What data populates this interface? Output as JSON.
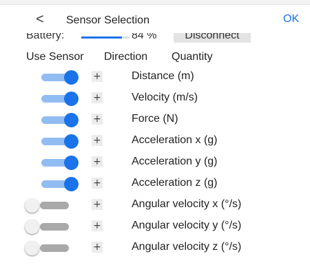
{
  "header": {
    "title": "Sensor Selection",
    "back_glyph": "<",
    "ok_label": "OK"
  },
  "status": {
    "battery_label": "Battery:",
    "battery_value": "84 %",
    "battery_level": 0.84,
    "disconnect_label": "Disconnect"
  },
  "columns": {
    "use_sensor": "Use Sensor",
    "direction": "Direction",
    "quantity": "Quantity"
  },
  "sensors": [
    {
      "quantity": "Distance (m)",
      "enabled": true,
      "direction_glyph": "+"
    },
    {
      "quantity": "Velocity (m/s)",
      "enabled": true,
      "direction_glyph": "+"
    },
    {
      "quantity": "Force (N)",
      "enabled": true,
      "direction_glyph": "+"
    },
    {
      "quantity": "Acceleration x (g)",
      "enabled": true,
      "direction_glyph": "+"
    },
    {
      "quantity": "Acceleration y (g)",
      "enabled": true,
      "direction_glyph": "+"
    },
    {
      "quantity": "Acceleration z (g)",
      "enabled": true,
      "direction_glyph": "+"
    },
    {
      "quantity": "Angular velocity x (°/s)",
      "enabled": false,
      "direction_glyph": "+"
    },
    {
      "quantity": "Angular velocity y (°/s)",
      "enabled": false,
      "direction_glyph": "+"
    },
    {
      "quantity": "Angular velocity z (°/s)",
      "enabled": false,
      "direction_glyph": "+"
    }
  ],
  "colors": {
    "accent": "#1a73e8",
    "track_on": "#90bcf2",
    "track_off": "#a9a9a9"
  }
}
